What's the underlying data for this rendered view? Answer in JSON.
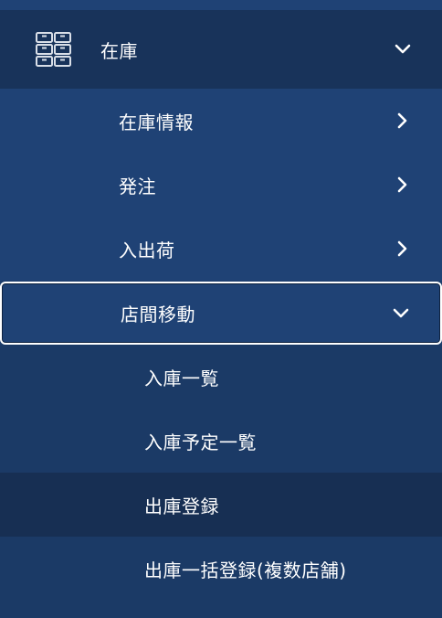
{
  "menu": {
    "header": {
      "label": "在庫",
      "icon": "grid-icon",
      "expanded": true
    },
    "items": [
      {
        "label": "在庫情報",
        "chevron": "chevron-right-icon"
      },
      {
        "label": "発注",
        "chevron": "chevron-right-icon"
      },
      {
        "label": "入出荷",
        "chevron": "chevron-right-icon"
      },
      {
        "label": "店間移動",
        "chevron": "chevron-down-icon",
        "selected": true
      }
    ],
    "subitems": [
      {
        "label": "入庫一覧"
      },
      {
        "label": "入庫予定一覧"
      },
      {
        "label": "出庫登録",
        "active": true
      },
      {
        "label": "出庫一括登録(複数店舗)"
      }
    ]
  },
  "colors": {
    "header_bg": "#18335a",
    "item_bg": "#1f4275",
    "subitem_bg": "#1b3a66",
    "subitem_active_bg": "#172f53",
    "text": "#ffffff"
  }
}
